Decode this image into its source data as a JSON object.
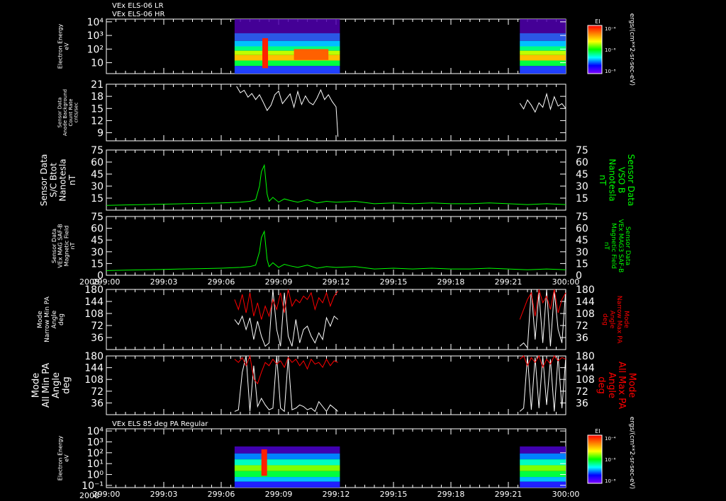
{
  "header": {
    "line1": "VEx ELS-06 LR",
    "line2": "VEx ELS-06 HR"
  },
  "panel7_title": "VEx ELS 85 deg PA Regular",
  "year": "2008",
  "xticks": [
    "299:00",
    "299:03",
    "299:06",
    "299:09",
    "299:12",
    "299:15",
    "299:18",
    "299:21",
    "300:00"
  ],
  "colorbar": {
    "label": "EI",
    "ticks": [
      "10⁻⁴",
      "10⁻⁶",
      "10⁻⁸"
    ],
    "units": "ergs/(cm**2-sr-sec-eV)",
    "colors": [
      "#ff0000",
      "#ff8000",
      "#ffff00",
      "#00ff00",
      "#00ffff",
      "#0000ff",
      "#8000ff"
    ]
  },
  "colors": {
    "white": "#ffffff",
    "green": "#00ff00",
    "red": "#ff0000",
    "frame": "#ffffff"
  },
  "chart_data": [
    {
      "type": "heatmap",
      "ylabel": [
        "Electron Energy",
        "eV"
      ],
      "yticks": [
        "10⁴",
        "10³",
        "10²",
        "10"
      ],
      "data_blocks": [
        {
          "x": [
            "299:06.7",
            "299:12.2"
          ]
        },
        {
          "x": [
            "299:21.6",
            "299:24.0"
          ]
        }
      ],
      "xlim": [
        "299:00",
        "300:00"
      ]
    },
    {
      "type": "line",
      "ylabel": [
        "Sensor Data",
        "Anode Background",
        "Count Rate",
        "cnts/sec"
      ],
      "yticks": [
        "21",
        "18",
        "15",
        "12",
        "9"
      ],
      "ylim": [
        7,
        21
      ],
      "series": [
        {
          "color": "#ffffff",
          "segments": [
            {
              "x": [
                6.8,
                7.0,
                7.2,
                7.4,
                7.6,
                7.8,
                8.0,
                8.2,
                8.4,
                8.6,
                8.8,
                9.0,
                9.2,
                9.4,
                9.6,
                9.8,
                10.0,
                10.2,
                10.4,
                10.6,
                10.8,
                11.0,
                11.2,
                11.4,
                11.6,
                11.8,
                12.0,
                12.1
              ],
              "y": [
                20.5,
                18.9,
                19.5,
                17.8,
                18.7,
                17.2,
                18.4,
                16.5,
                14.5,
                15.8,
                18.4,
                19.3,
                16.2,
                17.4,
                18.6,
                15.3,
                19.2,
                16.0,
                18.1,
                16.5,
                15.9,
                17.5,
                19.6,
                17.2,
                18.4,
                16.7,
                15.4,
                8.0
              ]
            },
            {
              "x": [
                21.6,
                21.8,
                22.0,
                22.2,
                22.4,
                22.6,
                22.8,
                23.0,
                23.2,
                23.4,
                23.6,
                23.8,
                24.0
              ],
              "y": [
                16.3,
                14.9,
                17.1,
                15.8,
                14.1,
                16.4,
                15.3,
                18.6,
                14.8,
                17.9,
                15.6,
                16.2,
                15.0
              ]
            }
          ]
        }
      ]
    },
    {
      "type": "line",
      "ylabel": [
        "Sensor Data",
        "S/C Btot",
        "Nanotesla",
        "nT"
      ],
      "ylabel_right": [
        "Sensor Data",
        "VSO B",
        "Nanotesla",
        "nT"
      ],
      "yticks": [
        "75",
        "60",
        "45",
        "30",
        "15"
      ],
      "ylim": [
        0,
        75
      ],
      "series": [
        {
          "color": "#00ff00",
          "x": [
            0,
            1,
            2,
            3,
            4,
            5,
            6,
            7,
            7.5,
            7.8,
            8.0,
            8.1,
            8.25,
            8.4,
            8.5,
            8.7,
            9.0,
            9.3,
            9.6,
            10,
            10.5,
            11,
            11.5,
            12,
            13,
            14,
            15,
            16,
            17,
            18,
            19,
            20,
            21,
            22,
            23,
            24
          ],
          "y": [
            6,
            6.5,
            7,
            7.5,
            8,
            8.5,
            9,
            10,
            11,
            13,
            30,
            48,
            56,
            20,
            11,
            16,
            10,
            14,
            12,
            10,
            13,
            9,
            11,
            10,
            11,
            8,
            9,
            8,
            9,
            8,
            8,
            9,
            8,
            7,
            8,
            7
          ]
        }
      ]
    },
    {
      "type": "line",
      "ylabel": [
        "Sensor Data",
        "VEx MAG SAF-B",
        "Magnetic Field",
        "nT"
      ],
      "ylabel_right": [
        "Sensor Data",
        "VEx MAG3 SAF-B",
        "Magnetic Field",
        "nT"
      ],
      "yticks": [
        "75",
        "60",
        "45",
        "30",
        "15",
        "0"
      ],
      "ylim": [
        0,
        75
      ],
      "series": [
        {
          "color": "#00ff00",
          "x": [
            0,
            1,
            2,
            3,
            4,
            5,
            6,
            7,
            7.5,
            7.8,
            8.0,
            8.1,
            8.25,
            8.4,
            8.5,
            8.7,
            9.0,
            9.3,
            9.6,
            10,
            10.5,
            11,
            11.5,
            12,
            13,
            14,
            15,
            16,
            17,
            18,
            19,
            20,
            21,
            22,
            23,
            24
          ],
          "y": [
            6,
            6.5,
            7,
            7.5,
            8,
            8.5,
            9,
            10,
            11,
            13,
            30,
            48,
            56,
            20,
            11,
            16,
            10,
            14,
            12,
            10,
            13,
            9,
            11,
            10,
            11,
            8,
            9,
            8,
            9,
            8,
            8,
            9,
            8,
            7,
            8,
            7
          ]
        }
      ]
    },
    {
      "type": "line",
      "ylabel": [
        "Mode",
        "Narrow Min PA",
        "Angle",
        "deg"
      ],
      "ylabel_right": [
        "Mode",
        "Narrow Max PA",
        "Angle",
        "deg"
      ],
      "yticks": [
        "180",
        "144",
        "108",
        "72",
        "36"
      ],
      "ylim": [
        0,
        180
      ],
      "series": [
        {
          "color": "#ffffff",
          "segments": [
            {
              "x": [
                6.7,
                6.9,
                7.1,
                7.3,
                7.5,
                7.7,
                7.9,
                8.1,
                8.3,
                8.5,
                8.7,
                8.9,
                9.1,
                9.3,
                9.5,
                9.7,
                9.9,
                10.1,
                10.3,
                10.5,
                10.7,
                10.9,
                11.1,
                11.3,
                11.5,
                11.7,
                11.9,
                12.1
              ],
              "y": [
                90,
                75,
                100,
                60,
                95,
                30,
                85,
                40,
                10,
                20,
                180,
                60,
                10,
                170,
                40,
                10,
                90,
                20,
                60,
                70,
                40,
                20,
                50,
                30,
                95,
                70,
                100,
                90
              ]
            },
            {
              "x": [
                21.6,
                21.8,
                22.0,
                22.2,
                22.4,
                22.6,
                22.8,
                23.0,
                23.2,
                23.4,
                23.6,
                23.8,
                24.0
              ],
              "y": [
                10,
                20,
                5,
                180,
                30,
                170,
                20,
                180,
                10,
                175,
                60,
                20,
                180
              ]
            }
          ]
        },
        {
          "color": "#ff0000",
          "segments": [
            {
              "x": [
                6.7,
                6.9,
                7.1,
                7.3,
                7.5,
                7.7,
                7.9,
                8.1,
                8.3,
                8.5,
                8.7,
                8.9,
                9.1,
                9.3,
                9.5,
                9.7,
                9.9,
                10.1,
                10.3,
                10.5,
                10.7,
                10.9,
                11.1,
                11.3,
                11.5,
                11.7,
                11.9,
                12.1
              ],
              "y": [
                150,
                120,
                165,
                110,
                170,
                100,
                140,
                90,
                130,
                100,
                150,
                120,
                170,
                110,
                180,
                130,
                150,
                140,
                160,
                150,
                170,
                120,
                155,
                140,
                170,
                130,
                160,
                175
              ]
            },
            {
              "x": [
                21.6,
                21.8,
                22.0,
                22.2,
                22.4,
                22.6,
                22.8,
                23.0,
                23.2,
                23.4,
                23.6,
                23.8,
                24.0
              ],
              "y": [
                90,
                120,
                150,
                170,
                100,
                180,
                140,
                160,
                120,
                180,
                110,
                150,
                170
              ]
            }
          ]
        }
      ]
    },
    {
      "type": "line",
      "ylabel": [
        "Mode",
        "All Min PA",
        "Angle",
        "deg"
      ],
      "ylabel_right": [
        "Mode",
        "All Max PA",
        "Angle",
        "deg"
      ],
      "yticks": [
        "180",
        "144",
        "108",
        "72",
        "36"
      ],
      "ylim": [
        0,
        180
      ],
      "series": [
        {
          "color": "#ffffff",
          "segments": [
            {
              "x": [
                6.7,
                6.9,
                7.1,
                7.3,
                7.5,
                7.7,
                7.9,
                8.1,
                8.3,
                8.5,
                8.7,
                8.9,
                9.1,
                9.3,
                9.5,
                9.7,
                9.9,
                10.1,
                10.3,
                10.5,
                10.7,
                10.9,
                11.1,
                11.3,
                11.5,
                11.7,
                11.9,
                12.1
              ],
              "y": [
                10,
                15,
                130,
                180,
                10,
                150,
                25,
                50,
                30,
                15,
                20,
                180,
                20,
                10,
                175,
                15,
                20,
                30,
                25,
                15,
                20,
                10,
                40,
                25,
                10,
                30,
                20,
                10
              ]
            },
            {
              "x": [
                21.6,
                21.8,
                22.0,
                22.2,
                22.4,
                22.6,
                22.8,
                23.0,
                23.2,
                23.4,
                23.6,
                23.8,
                24.0
              ],
              "y": [
                10,
                20,
                180,
                15,
                175,
                20,
                180,
                30,
                170,
                10,
                180,
                20,
                175
              ]
            }
          ]
        },
        {
          "color": "#ff0000",
          "segments": [
            {
              "x": [
                6.7,
                6.9,
                7.1,
                7.3,
                7.5,
                7.7,
                7.9,
                8.1,
                8.3,
                8.5,
                8.7,
                8.9,
                9.1,
                9.3,
                9.5,
                9.7,
                9.9,
                10.1,
                10.3,
                10.5,
                10.7,
                10.9,
                11.1,
                11.3,
                11.5,
                11.7,
                11.9,
                12.1
              ],
              "y": [
                170,
                160,
                175,
                150,
                180,
                110,
                95,
                130,
                160,
                150,
                170,
                155,
                165,
                145,
                175,
                160,
                170,
                150,
                165,
                140,
                170,
                155,
                160,
                145,
                170,
                150,
                165,
                160
              ]
            },
            {
              "x": [
                21.6,
                21.8,
                22.0,
                22.2,
                22.4,
                22.6,
                22.8,
                23.0,
                23.2,
                23.4,
                23.6,
                23.8,
                24.0
              ],
              "y": [
                170,
                180,
                150,
                175,
                160,
                180,
                145,
                170,
                155,
                180,
                165,
                175,
                170
              ]
            }
          ]
        }
      ]
    },
    {
      "type": "heatmap",
      "ylabel": [
        "Electron Energy",
        "eV"
      ],
      "yticks": [
        "10⁴",
        "10³",
        "10²",
        "10¹",
        "10⁰",
        "10⁻¹"
      ],
      "data_blocks": [
        {
          "x": [
            "299:06.7",
            "299:12.2"
          ]
        },
        {
          "x": [
            "299:21.6",
            "299:24.0"
          ]
        }
      ],
      "xlim": [
        "299:00",
        "300:00"
      ]
    }
  ]
}
